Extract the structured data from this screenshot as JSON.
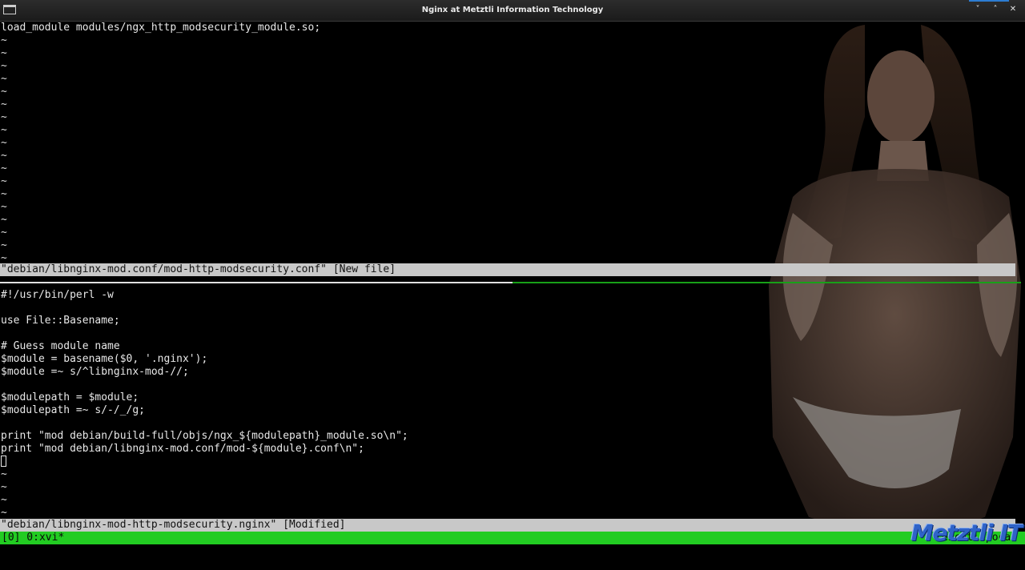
{
  "window": {
    "title": "Nginx at Metztli Information Technology",
    "minimize_glyph": "˅",
    "maximize_glyph": "˄",
    "close_glyph": "✕"
  },
  "top_pane": {
    "lines": [
      "load_module modules/ngx_http_modsecurity_module.so;"
    ],
    "tilde_count": 18,
    "status": "\"debian/libnginx-mod.conf/mod-http-modsecurity.conf\" [New file]"
  },
  "bottom_pane": {
    "lines": [
      "#!/usr/bin/perl -w",
      "",
      "use File::Basename;",
      "",
      "# Guess module name",
      "$module = basename($0, '.nginx');",
      "$module =~ s/^libnginx-mod-//;",
      "",
      "$modulepath = $module;",
      "$modulepath =~ s/-/_/g;",
      "",
      "print \"mod debian/build-full/objs/ngx_${modulepath}_module.so\\n\";",
      "print \"mod debian/libnginx-mod.conf/mod-${module}.conf\\n\";"
    ],
    "tilde_count": 4,
    "status": "\"debian/libnginx-mod-http-modsecurity.nginx\" [Modified]"
  },
  "tmux": {
    "left": "[0] 0:xvi*",
    "right": "\"tezcatlipoca\""
  },
  "watermark": "Metztli IT"
}
